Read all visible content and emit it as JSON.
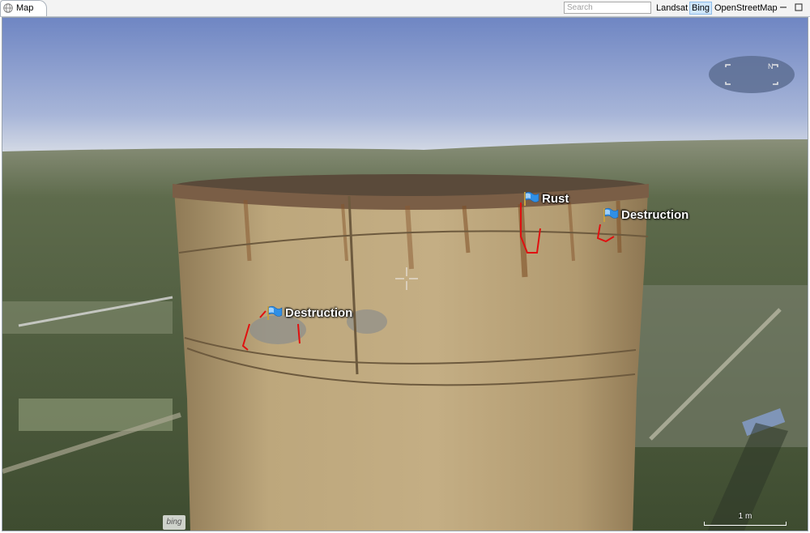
{
  "window": {
    "tab_title": "Map",
    "tab_icon": "globe-icon"
  },
  "toolbar": {
    "search_placeholder": "Search",
    "layers": [
      "Landsat",
      "Bing",
      "OpenStreetMap"
    ],
    "active_layer": "Bing",
    "minimize_icon": "minimize-icon",
    "maximize_icon": "maximize-icon"
  },
  "map": {
    "markers": [
      {
        "label": "Rust",
        "icon": "flag-icon"
      },
      {
        "label": "Destruction",
        "icon": "flag-icon"
      },
      {
        "label": "Destruction",
        "icon": "flag-icon"
      }
    ],
    "compass_icon": "compass-icon",
    "crosshair_icon": "crosshair-icon",
    "scale_label": "1 m",
    "attribution": "bing",
    "colors": {
      "sky_top": "#7288c4",
      "sky_horizon": "#d5dbe6",
      "tower": "#b39a70",
      "annotation": "#e01010"
    }
  }
}
